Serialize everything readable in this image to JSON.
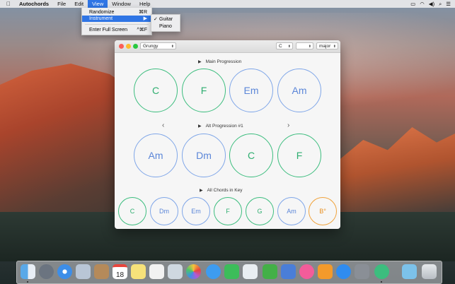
{
  "menubar": {
    "app_name": "Autochords",
    "menus": [
      "File",
      "Edit",
      "View",
      "Window",
      "Help"
    ],
    "active_menu": "View"
  },
  "view_menu": {
    "randomize": {
      "label": "Randomize",
      "shortcut": "⌘R"
    },
    "instrument": {
      "label": "Instrument",
      "shortcut": "▶"
    },
    "full_screen": {
      "label": "Enter Full Screen",
      "shortcut": "^⌘F"
    }
  },
  "instrument_submenu": {
    "guitar": {
      "label": "Guitar",
      "checked": "✓"
    },
    "piano": {
      "label": "Piano"
    }
  },
  "toolbar": {
    "style": "Grungy",
    "key": "C",
    "accidental": "",
    "mode": "major"
  },
  "main_progression": {
    "title": "Main Progression",
    "chords": [
      {
        "name": "C",
        "color": "green"
      },
      {
        "name": "F",
        "color": "green"
      },
      {
        "name": "Em",
        "color": "blue"
      },
      {
        "name": "Am",
        "color": "blue"
      }
    ]
  },
  "alt_progression": {
    "title": "Alt Progression #1",
    "chords": [
      {
        "name": "Am",
        "color": "blue"
      },
      {
        "name": "Dm",
        "color": "blue"
      },
      {
        "name": "C",
        "color": "green"
      },
      {
        "name": "F",
        "color": "green"
      }
    ]
  },
  "all_chords": {
    "title": "All Chords in Key",
    "chords": [
      {
        "name": "C",
        "color": "green"
      },
      {
        "name": "Dm",
        "color": "blue"
      },
      {
        "name": "Em",
        "color": "blue"
      },
      {
        "name": "F",
        "color": "green"
      },
      {
        "name": "G",
        "color": "green"
      },
      {
        "name": "Am",
        "color": "blue"
      },
      {
        "name": "B°",
        "color": "orange"
      }
    ]
  },
  "colors": {
    "green": "#3cbd7e",
    "blue": "#7fa6e8",
    "orange": "#f0a33c",
    "menu_highlight": "#2f75e5"
  },
  "status_icons": [
    "screen-mirroring-icon",
    "wifi-icon",
    "volume-icon",
    "spotlight-icon",
    "notification-center-icon"
  ],
  "dock_icons": [
    "finder-icon",
    "launchpad-icon",
    "safari-icon",
    "mail-icon",
    "contacts-icon",
    "calendar-icon",
    "notes-icon",
    "reminders-icon",
    "preview-icon",
    "photos-icon",
    "messages-icon",
    "facetime-icon",
    "numbers-icon",
    "keynote-icon",
    "itunes-icon",
    "ibooks-icon",
    "app-store-icon",
    "system-preferences-icon",
    "autochords-icon",
    "downloads-folder-icon",
    "trash-icon"
  ],
  "calendar_day": "18"
}
